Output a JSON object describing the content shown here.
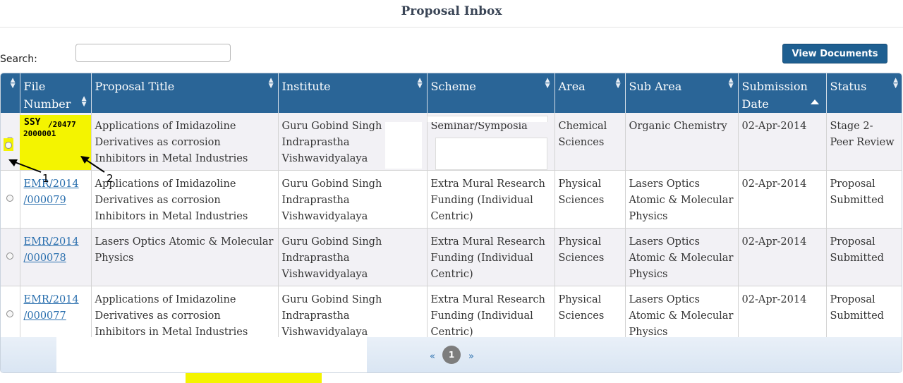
{
  "page": {
    "title": "Proposal Inbox"
  },
  "search": {
    "label": "Search:",
    "value": ""
  },
  "toolbar": {
    "view_documents": "View Documents"
  },
  "columns": [
    "File Number",
    "Proposal Title",
    "Institute",
    "Scheme",
    "Area",
    "Sub Area",
    "Submission Date",
    "Status"
  ],
  "rows": [
    {
      "file_number": "",
      "file_note_line1": "SSY",
      "file_note_line2": "/20477",
      "file_note_line3": "2000001",
      "title": "Applications of Imidazoline Derivatives as corrosion Inhibitors in Metal Industries",
      "institute": "Guru Gobind Singh Indraprastha Vishwavidyalaya",
      "scheme": "Seminar/Symposia",
      "area": "Chemical Sciences",
      "sub_area": "Organic Chemistry",
      "date": "02-Apr-2014",
      "status": "Stage 2- Peer Review"
    },
    {
      "file_number_line1": "EMR/2014",
      "file_number_line2": "/000079",
      "title": "Applications of Imidazoline Derivatives as corrosion Inhibitors in Metal Industries",
      "institute": "Guru Gobind Singh Indraprastha Vishwavidyalaya",
      "scheme": "Extra Mural Research Funding (Individual Centric)",
      "area": "Physical Sciences",
      "sub_area": "Lasers Optics Atomic & Molecular Physics",
      "date": "02-Apr-2014",
      "status": "Proposal Submitted"
    },
    {
      "file_number_line1": "EMR/2014",
      "file_number_line2": "/000078",
      "title": "Lasers Optics Atomic & Molecular Physics",
      "institute": "Guru Gobind Singh Indraprastha Vishwavidyalaya",
      "scheme": "Extra Mural Research Funding (Individual Centric)",
      "area": "Physical Sciences",
      "sub_area": "Lasers Optics Atomic & Molecular Physics",
      "date": "02-Apr-2014",
      "status": "Proposal Submitted"
    },
    {
      "file_number_line1": "EMR/2014",
      "file_number_line2": "/000077",
      "title": "Applications of Imidazoline Derivatives as corrosion Inhibitors in Metal Industries",
      "institute": "Guru Gobind Singh Indraprastha Vishwavidyalaya",
      "scheme": "Extra Mural Research Funding (Individual Centric)",
      "area": "Physical Sciences",
      "sub_area": "Lasers Optics Atomic & Molecular Physics",
      "date": "02-Apr-2014",
      "status": "Proposal Submitted"
    }
  ],
  "annotations": {
    "label_1": "1",
    "label_2": "2"
  },
  "pagination": {
    "prev": "«",
    "current": "1",
    "next": "»"
  }
}
